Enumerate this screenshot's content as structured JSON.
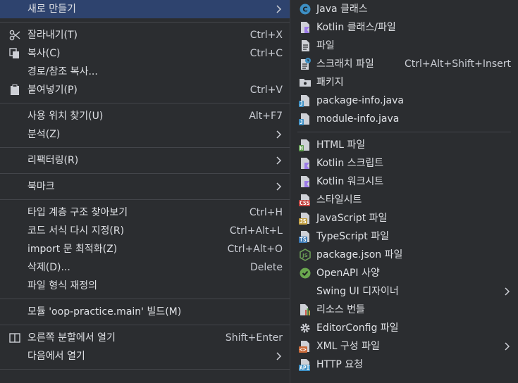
{
  "left_menu": [
    {
      "type": "item",
      "name": "new",
      "label": "새로 만들기",
      "submenu": true,
      "selected": true
    },
    {
      "type": "sep"
    },
    {
      "type": "item",
      "name": "cut",
      "icon": "scissors",
      "label": "잘라내기(T)",
      "shortcut": "Ctrl+X"
    },
    {
      "type": "item",
      "name": "copy",
      "icon": "copy",
      "label": "복사(C)",
      "shortcut": "Ctrl+C"
    },
    {
      "type": "item",
      "name": "copy-path",
      "label": "경로/참조 복사..."
    },
    {
      "type": "item",
      "name": "paste",
      "icon": "clipboard",
      "label": "붙여넣기(P)",
      "shortcut": "Ctrl+V"
    },
    {
      "type": "sep"
    },
    {
      "type": "item",
      "name": "find-usages",
      "label": "사용 위치 찾기(U)",
      "shortcut": "Alt+F7"
    },
    {
      "type": "item",
      "name": "analyze",
      "label": "분석(Z)",
      "submenu": true
    },
    {
      "type": "sep"
    },
    {
      "type": "item",
      "name": "refactor",
      "label": "리팩터링(R)",
      "submenu": true
    },
    {
      "type": "sep"
    },
    {
      "type": "item",
      "name": "bookmarks",
      "label": "북마크",
      "submenu": true
    },
    {
      "type": "sep"
    },
    {
      "type": "item",
      "name": "type-hierarchy",
      "label": "타입 계층 구조 찾아보기",
      "shortcut": "Ctrl+H"
    },
    {
      "type": "item",
      "name": "reformat-code",
      "label": "코드 서식 다시 지정(R)",
      "shortcut": "Ctrl+Alt+L"
    },
    {
      "type": "item",
      "name": "optimize-imports",
      "label": "import 문 최적화(Z)",
      "shortcut": "Ctrl+Alt+O"
    },
    {
      "type": "item",
      "name": "delete",
      "label": "삭제(D)...",
      "shortcut": "Delete"
    },
    {
      "type": "item",
      "name": "override-file-type",
      "label": "파일 형식 재정의"
    },
    {
      "type": "sep"
    },
    {
      "type": "item",
      "name": "build-module",
      "label": "모듈 'oop-practice.main' 빌드(M)"
    },
    {
      "type": "sep"
    },
    {
      "type": "item",
      "name": "open-right-split",
      "icon": "split",
      "label": "오른쪽 분할에서 열기",
      "shortcut": "Shift+Enter"
    },
    {
      "type": "item",
      "name": "open-in",
      "label": "다음에서 열기",
      "submenu": true
    },
    {
      "type": "sep"
    }
  ],
  "right_menu": [
    {
      "type": "item",
      "name": "java-class",
      "icon": "java-class",
      "label": "Java 클래스"
    },
    {
      "type": "item",
      "name": "kotlin-class-file",
      "icon": "kotlin",
      "label": "Kotlin 클래스/파일"
    },
    {
      "type": "item",
      "name": "file",
      "icon": "file",
      "label": "파일"
    },
    {
      "type": "item",
      "name": "scratch-file",
      "icon": "scratch",
      "label": "스크래치 파일",
      "shortcut": "Ctrl+Alt+Shift+Insert"
    },
    {
      "type": "item",
      "name": "package",
      "icon": "package",
      "label": "패키지"
    },
    {
      "type": "item",
      "name": "package-info",
      "icon": "java-file",
      "label": "package-info.java"
    },
    {
      "type": "item",
      "name": "module-info",
      "icon": "java-file",
      "label": "module-info.java"
    },
    {
      "type": "sep"
    },
    {
      "type": "item",
      "name": "html-file",
      "icon": "html",
      "label": "HTML 파일"
    },
    {
      "type": "item",
      "name": "kotlin-script",
      "icon": "kotlin",
      "label": "Kotlin 스크립트"
    },
    {
      "type": "item",
      "name": "kotlin-worksheet",
      "icon": "kotlin",
      "label": "Kotlin 워크시트"
    },
    {
      "type": "item",
      "name": "stylesheet",
      "icon": "css",
      "label": "스타일시트"
    },
    {
      "type": "item",
      "name": "javascript-file",
      "icon": "js",
      "label": "JavaScript 파일"
    },
    {
      "type": "item",
      "name": "typescript-file",
      "icon": "ts",
      "label": "TypeScript 파일"
    },
    {
      "type": "item",
      "name": "package-json",
      "icon": "nodejs",
      "label": "package.json 파일"
    },
    {
      "type": "item",
      "name": "openapi-spec",
      "icon": "openapi",
      "label": "OpenAPI 사양"
    },
    {
      "type": "item",
      "name": "swing-ui-designer",
      "label": "Swing UI 디자이너",
      "submenu": true
    },
    {
      "type": "item",
      "name": "resource-bundle",
      "icon": "bundle",
      "label": "리소스 번들"
    },
    {
      "type": "item",
      "name": "editorconfig",
      "icon": "gear",
      "label": "EditorConfig 파일"
    },
    {
      "type": "item",
      "name": "xml-config",
      "icon": "xml",
      "label": "XML 구성 파일",
      "submenu": true
    },
    {
      "type": "item",
      "name": "http-request",
      "icon": "api",
      "label": "HTTP 요청"
    }
  ],
  "badges": {
    "css": "CSS",
    "js": "JS",
    "ts": "TS",
    "html": "H",
    "java": "J",
    "api": "API",
    "xml": "<>",
    "java_class": "C"
  },
  "colors": {
    "selected": "#2e436e",
    "java_blue": "#3d8fc4",
    "kotlin": "#9b7ae8",
    "css": "#c3423f",
    "js": "#c4a042",
    "ts": "#3b78b4",
    "html": "#5a9a49",
    "nodejs": "#6a9c55",
    "openapi": "#6aa84f"
  }
}
